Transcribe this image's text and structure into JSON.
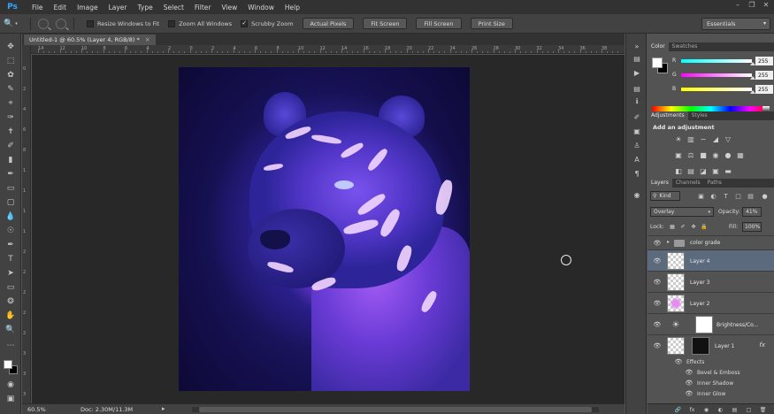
{
  "app": {
    "logo": "Ps",
    "menus": [
      "File",
      "Edit",
      "Image",
      "Layer",
      "Type",
      "Select",
      "Filter",
      "View",
      "Window",
      "Help"
    ]
  },
  "options": {
    "resize_windows": "Resize Windows to Fit",
    "zoom_all_windows": "Zoom All Windows",
    "scrubby_zoom": "Scrubby Zoom",
    "actual_pixels": "Actual Pixels",
    "fit_screen": "Fit Screen",
    "fill_screen": "Fill Screen",
    "print_size": "Print Size",
    "workspace": "Essentials"
  },
  "document": {
    "tab_title": "Untitled-1 @ 60.5% (Layer 4, RGB/8) *",
    "zoom": "60.5%",
    "doc_info": "Doc: 2.30M/11.3M"
  },
  "ruler": {
    "top_labels": [
      "14",
      "12",
      "10",
      "8",
      "6",
      "4",
      "2",
      "0",
      "2",
      "4",
      "6",
      "8",
      "10",
      "12",
      "14",
      "16",
      "18",
      "20",
      "22",
      "24",
      "26",
      "28",
      "30",
      "32",
      "34",
      "36",
      "38"
    ],
    "left_labels": [
      "0",
      "2",
      "4",
      "6",
      "8",
      "1",
      "1",
      "1",
      "1",
      "2",
      "2",
      "2",
      "2",
      "2",
      "3",
      "3",
      "3"
    ]
  },
  "color_panel": {
    "tabs": [
      "Color",
      "Swatches"
    ],
    "r_label": "R",
    "g_label": "G",
    "b_label": "B",
    "r_value": "255",
    "g_value": "255",
    "b_value": "255"
  },
  "adjustments_panel": {
    "tabs": [
      "Adjustments",
      "Styles"
    ],
    "title": "Add an adjustment"
  },
  "layers_panel": {
    "tabs": [
      "Layers",
      "Channels",
      "Paths"
    ],
    "filter_kind": "Kind",
    "blend_mode": "Overlay",
    "opacity_label": "Opacity:",
    "opacity_value": "41%",
    "lock_label": "Lock:",
    "fill_label": "Fill:",
    "fill_value": "100%",
    "layers": [
      {
        "name": "color grade"
      },
      {
        "name": "Layer 4"
      },
      {
        "name": "Layer 3"
      },
      {
        "name": "Layer 2"
      },
      {
        "name": "Brightness/Co..."
      },
      {
        "name": "Layer 1",
        "fx": "fx"
      }
    ],
    "effects_label": "Effects",
    "effects": [
      "Bevel & Emboss",
      "Inner Shadow",
      "Inner Glow"
    ]
  }
}
